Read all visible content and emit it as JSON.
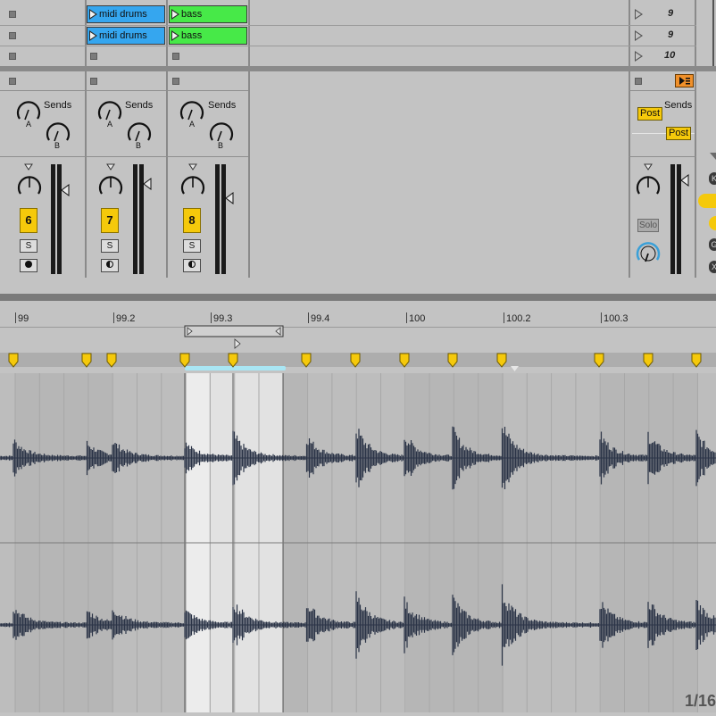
{
  "clip_grid": {
    "rows": [
      {
        "clips": [
          {
            "label": "midi drums",
            "color": "#35a6ef"
          },
          {
            "label": "bass",
            "color": "#47e948"
          }
        ],
        "scene_number": "9"
      },
      {
        "clips": [
          {
            "label": "midi drums",
            "color": "#35a6ef"
          },
          {
            "label": "bass",
            "color": "#47e948"
          }
        ],
        "scene_number": "9"
      },
      {
        "clips": [],
        "scene_number": "10"
      }
    ]
  },
  "mixer": {
    "tracks": [
      {
        "sends_label": "Sends",
        "send_a": "A",
        "send_b": "B",
        "number": "6",
        "solo": "S"
      },
      {
        "sends_label": "Sends",
        "send_a": "A",
        "send_b": "B",
        "number": "7",
        "solo": "S"
      },
      {
        "sends_label": "Sends",
        "send_a": "A",
        "send_b": "B",
        "number": "8",
        "solo": "S"
      }
    ],
    "master": {
      "sends_label": "Sends",
      "post_a": "Post",
      "post_b": "Post",
      "solo_label": "Solo"
    }
  },
  "sample_view": {
    "ruler_labels": [
      "99",
      "99.2",
      "99.3",
      "99.4",
      "100",
      "100.2",
      "100.3"
    ],
    "zoom_label": "1/16"
  },
  "colors": {
    "accent_orange": "#f0902a",
    "track_number_yellow": "#f5c90b",
    "loop_brace_blue": "#a9e6f4",
    "waveform": "#2b3447"
  }
}
